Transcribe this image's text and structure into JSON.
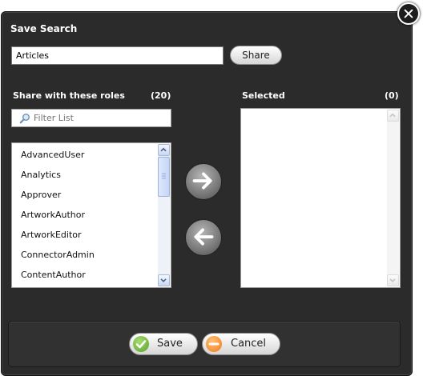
{
  "dialog": {
    "title": "Save Search",
    "close_icon": "close-x-icon",
    "name_value": "Articles",
    "share_label": "Share"
  },
  "available": {
    "heading": "Share with these roles",
    "count": "(20)",
    "filter_placeholder": "Filter List",
    "filter_icon": "magnifier-icon",
    "items": [
      "AdvancedUser",
      "Analytics",
      "Approver",
      "ArtworkAuthor",
      "ArtworkEditor",
      "ConnectorAdmin",
      "ContentAuthor"
    ]
  },
  "selected": {
    "heading": "Selected",
    "count": "(0)",
    "items": []
  },
  "transfer": {
    "add_icon": "arrow-right-icon",
    "remove_icon": "arrow-left-icon"
  },
  "footer": {
    "save_label": "Save",
    "save_icon": "check-icon",
    "cancel_label": "Cancel",
    "cancel_icon": "minus-icon"
  },
  "colors": {
    "dialog_bg": "#2b2b2b",
    "save_icon_color": "#5aa02c",
    "cancel_icon_color": "#f07a14"
  }
}
